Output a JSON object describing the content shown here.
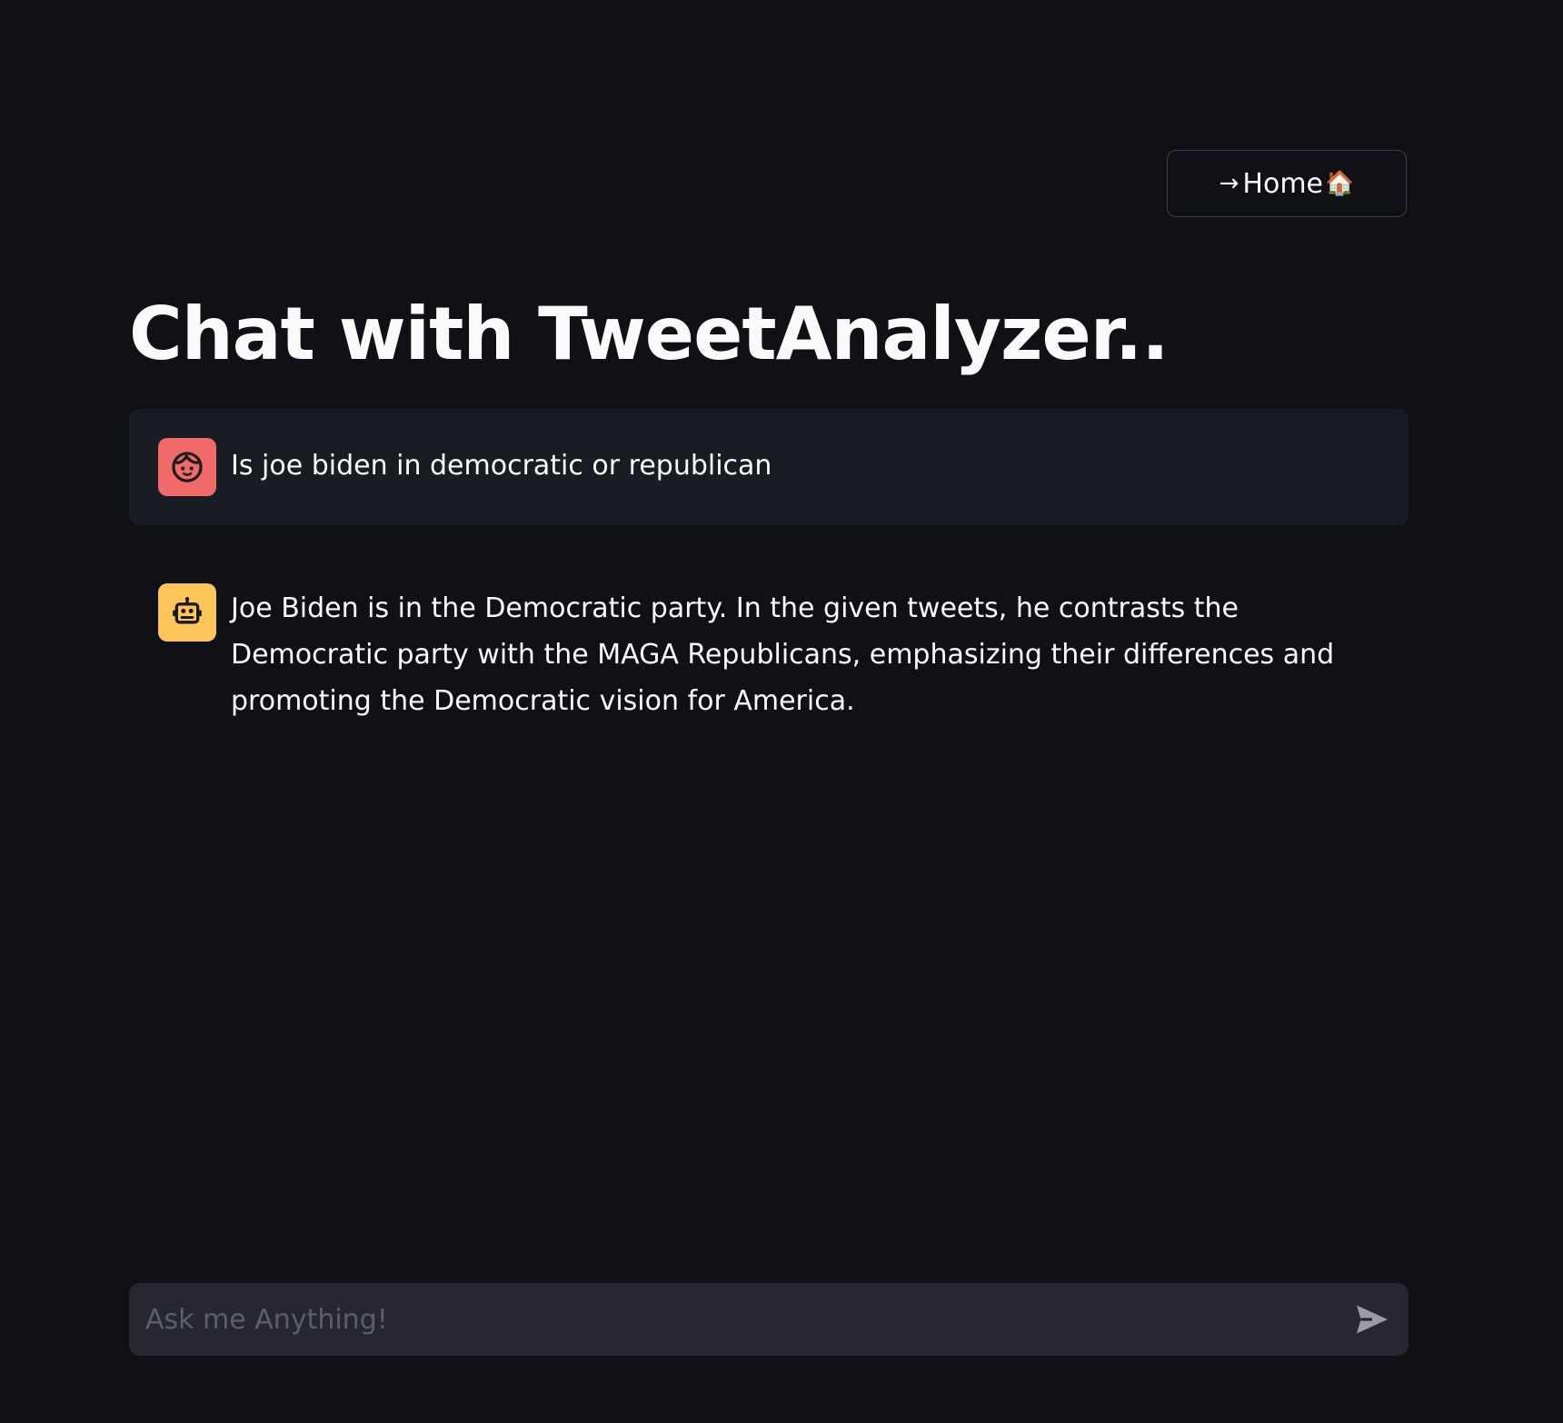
{
  "header": {
    "home_button": {
      "arrow": "→",
      "label": "Home",
      "emoji": "🏠"
    }
  },
  "title": "Chat with TweetAnalyzer..",
  "messages": [
    {
      "role": "user",
      "avatar_icon": "user-face-icon",
      "avatar_color": "#f06a6a",
      "text": "Is joe biden in democratic or republican"
    },
    {
      "role": "assistant",
      "avatar_icon": "robot-icon",
      "avatar_color": "#fcc55c",
      "text": "Joe Biden is in the Democratic party. In the given tweets, he contrasts the Democratic party with the MAGA Republicans, emphasizing their differences and promoting the Democratic vision for America."
    }
  ],
  "chat_input": {
    "placeholder": "Ask me Anything!",
    "value": "",
    "send_icon": "send-icon"
  },
  "colors": {
    "background": "#0f1117",
    "user_message_bg": "#1a1c24",
    "input_bg": "#262730",
    "text": "#fafafa"
  }
}
